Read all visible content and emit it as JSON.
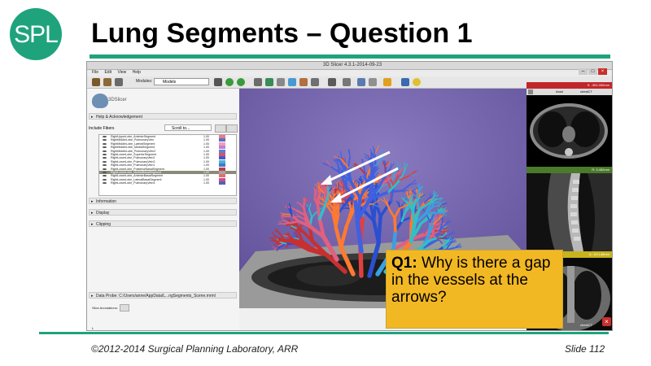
{
  "slide": {
    "logo_text": "SPL",
    "title": "Lung Segments – Question 1",
    "footer_left": "©2012-2014 Surgical Planning Laboratory, ARR",
    "footer_right": "Slide 112",
    "colors": {
      "accent": "#1fa37d",
      "question_bg": "#f2b824"
    }
  },
  "question": {
    "label": "Q1:",
    "text": "Why is there a gap in the vessels at the arrows?"
  },
  "slicer": {
    "window_title": "3D Slicer 4.3.1-2014-09-23",
    "menu": [
      "File",
      "Edit",
      "View",
      "Help"
    ],
    "modules_label": "Modules:",
    "module_selected": "Models",
    "brand": "3DSlicer",
    "sections": {
      "help": "Help & Acknowledgement",
      "information": "Information",
      "display": "Display",
      "clipping": "Clipping"
    },
    "include_fibers_label": "Include Fibers",
    "scroll_to_placeholder": "Scroll to...",
    "fibers": [
      {
        "name": "RightUpperLobe_AnteriorSegment",
        "value": "1.00",
        "color": "#e87c8a"
      },
      {
        "name": "RightMiddleLobe_PulmonaryVein",
        "value": "1.00",
        "color": "#5a6fc0"
      },
      {
        "name": "RightMiddleLobe_LateralSegment",
        "value": "1.00",
        "color": "#e9a0c0"
      },
      {
        "name": "RightMiddleLobe_MedialSegment",
        "value": "1.00",
        "color": "#c47fd0"
      },
      {
        "name": "RightMiddleLobe_PulmonaryVein2",
        "value": "1.00",
        "color": "#4f86d8"
      },
      {
        "name": "RightLowerLobe_SuperiorSegment",
        "value": "1.00",
        "color": "#e05060"
      },
      {
        "name": "RightLowerLobe_PulmonaryVein2",
        "value": "1.00",
        "color": "#3a5fcf"
      },
      {
        "name": "RightLowerLobe_PulmonaryVein3",
        "value": "1.00",
        "color": "#4fb0d0"
      },
      {
        "name": "RightLowerLobe_PulmonaryVein1",
        "value": "1.00",
        "color": "#3d7ad8"
      },
      {
        "name": "RightLowerLobe_PosteriorBasalSegment",
        "value": "1.00",
        "color": "#c04040"
      },
      {
        "name": "RightLowerLobe_MedialBasalSegment",
        "value": "1.00",
        "color": "#a6a6a6"
      },
      {
        "name": "RightLowerLobe_AnteriorBasalSegment",
        "value": "1.00",
        "color": "#e07070"
      },
      {
        "name": "RightLowerLobe_LateralBasalSegment",
        "value": "1.00",
        "color": "#d05080"
      },
      {
        "name": "RightLowerLobe_PulmonaryVein4",
        "value": "1.00",
        "color": "#5060c0"
      }
    ],
    "selected_fiber_index": 10,
    "data_probe": "Data Probe: C:/Users/anne/AppData/L...ngSegments_Scene.mrml",
    "slice_annotations_label": "Slice Annotations:",
    "probe_letters": [
      "L",
      "F",
      "B"
    ],
    "slice_views": {
      "red": {
        "offset": "S: -301.000mm",
        "orientation": "Axial",
        "volume": "chestCT"
      },
      "green": {
        "offset": "R: 3.452mm"
      },
      "yellow": {
        "offset": "A: -63.148mm",
        "volume": "chestCT"
      }
    }
  }
}
